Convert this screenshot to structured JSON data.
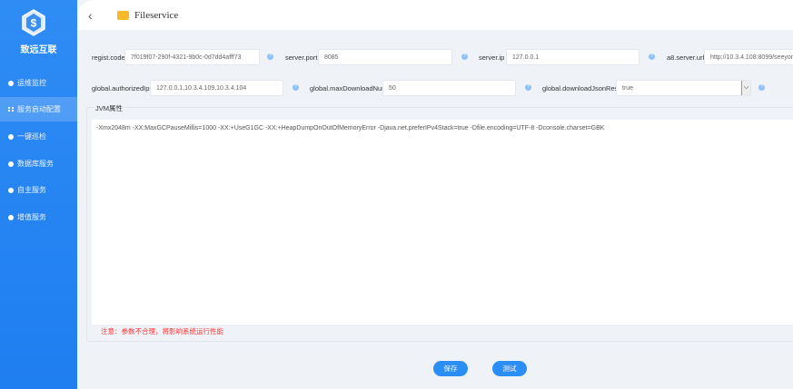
{
  "sidebar": {
    "brand": "致远互联",
    "items": [
      {
        "label": "运维监控",
        "icon": "monitor-icon"
      },
      {
        "label": "服务启动配置",
        "icon": "grid-icon",
        "active": true
      },
      {
        "label": "一键巡检",
        "icon": "inspect-icon"
      },
      {
        "label": "数据库服务",
        "icon": "database-icon"
      },
      {
        "label": "自主服务",
        "icon": "shield-icon"
      },
      {
        "label": "增值服务",
        "icon": "plus-icon"
      }
    ]
  },
  "header": {
    "title": "Fileservice"
  },
  "form": {
    "regist_code": {
      "label": "regist.code",
      "value": "7f019f07-290f-4321-9b0c-0d7dd4afff73"
    },
    "server_port": {
      "label": "server.port",
      "value": "8085"
    },
    "server_ip": {
      "label": "server.ip",
      "value": "127.0.0.1"
    },
    "a8_server_url": {
      "label": "a8.server.url",
      "value": "http://10.3.4.108:8099/seeyon"
    },
    "authorized_ips": {
      "label": "global.authorizedIps",
      "value": "127.0.0.1,10.3.4.109,10.3.4.104"
    },
    "max_download": {
      "label": "global.maxDownloadNum",
      "value": "50"
    },
    "download_json": {
      "label": "global.downloadJsonResp",
      "value": "true"
    }
  },
  "jvm": {
    "legend": "JVM属性",
    "value": "-Xmx2048m -XX:MaxGCPauseMillis=1000 -XX:+UseG1GC -XX:+HeapDumpOnOutOfMemoryError -Djava.net.preferIPv4Stack=true -Dfile.encoding=UTF-8 -Dconsole.charset=GBK",
    "warning": "注意：参数不合理，将影响系统运行性能"
  },
  "actions": {
    "save": "保存",
    "test": "测试"
  },
  "colors": {
    "sidebar": "#2f8cf5",
    "button": "#2a8ef6",
    "warning": "#ff3333"
  }
}
